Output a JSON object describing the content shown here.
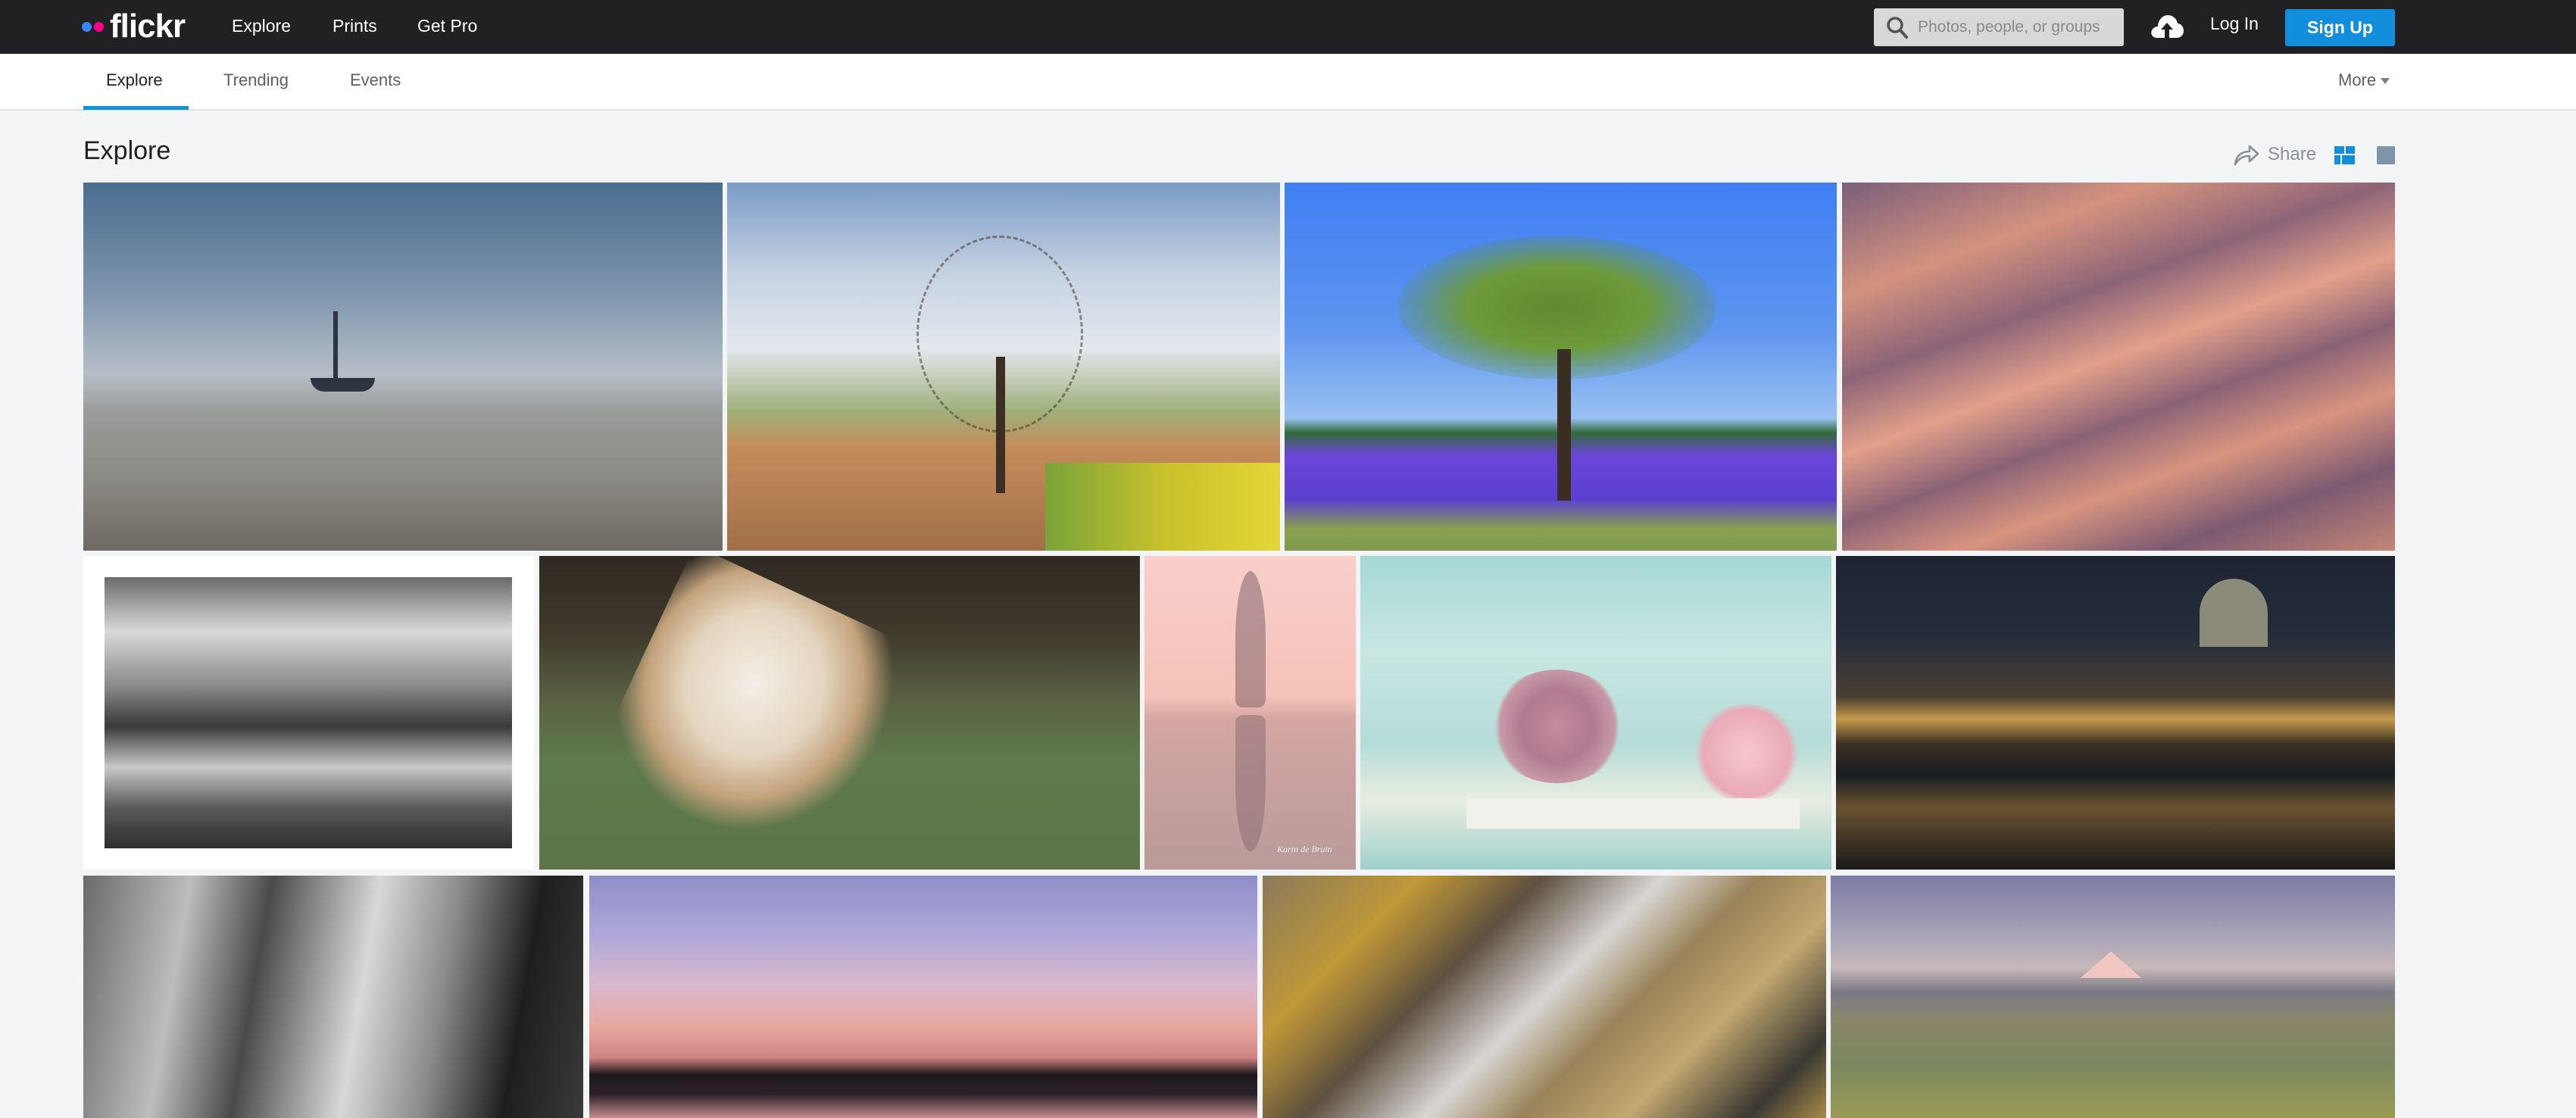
{
  "header": {
    "logo_text": "flickr",
    "logo_colors": {
      "blue": "#3e82f7",
      "pink": "#ff0084"
    },
    "nav": [
      {
        "label": "Explore"
      },
      {
        "label": "Prints"
      },
      {
        "label": "Get Pro"
      }
    ],
    "search": {
      "placeholder": "Photos, people, or groups",
      "value": "",
      "icon": "search-icon"
    },
    "upload_icon": "cloud-upload-icon",
    "login_label": "Log In",
    "signup_label": "Sign Up",
    "accent_color": "#128fdc"
  },
  "subnav": {
    "tabs": [
      {
        "label": "Explore",
        "active": true
      },
      {
        "label": "Trending",
        "active": false
      },
      {
        "label": "Events",
        "active": false
      }
    ],
    "more_label": "More"
  },
  "main": {
    "title": "Explore",
    "share_label": "Share",
    "view_modes": [
      {
        "icon": "grid-view-icon",
        "active": true
      },
      {
        "icon": "single-view-icon",
        "active": false
      }
    ],
    "photos": [
      {
        "subject": "Foggy tidal flat with sailboat",
        "row": 1
      },
      {
        "subject": "Bare tree beside dirt road and rapeseed field",
        "row": 1
      },
      {
        "subject": "Tree in lavender field under blue sky",
        "row": 1
      },
      {
        "subject": "Pink sand dunes",
        "row": 1
      },
      {
        "subject": "Black and white canal with house reflection",
        "row": 2
      },
      {
        "subject": "Barn owl in flight",
        "row": 2
      },
      {
        "subject": "Misty pink tree reflection",
        "row": 2,
        "watermark": "Karin de Bruin"
      },
      {
        "subject": "Pink roses, teapot and yarn ball",
        "row": 2
      },
      {
        "subject": "Night view of Rome bridge and St. Peter's dome",
        "row": 2
      },
      {
        "subject": "Black and white castle with street lamp",
        "row": 3
      },
      {
        "subject": "Pink sunset over lake with trees",
        "row": 3
      },
      {
        "subject": "Stream flowing over mossy rocks",
        "row": 3
      },
      {
        "subject": "Mountain landscape with yellow wildflowers",
        "row": 3
      }
    ]
  }
}
